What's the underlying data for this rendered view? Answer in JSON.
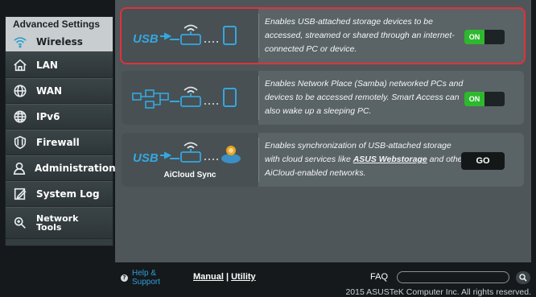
{
  "sidebar": {
    "header": "Advanced Settings",
    "items": [
      {
        "label": "Wireless",
        "icon": "wifi-icon"
      },
      {
        "label": "LAN",
        "icon": "home-icon"
      },
      {
        "label": "WAN",
        "icon": "globe-icon"
      },
      {
        "label": "IPv6",
        "icon": "ipv6-globe-icon"
      },
      {
        "label": "Firewall",
        "icon": "shield-icon"
      },
      {
        "label": "Administration",
        "icon": "person-icon"
      },
      {
        "label": "System Log",
        "icon": "log-pencil-icon"
      },
      {
        "label": "Network",
        "label2": "Tools",
        "icon": "network-tools-icon"
      }
    ]
  },
  "cards": [
    {
      "description": "Enables USB-attached storage devices to be accessed, streamed or shared through an internet-connected PC or device.",
      "toggle": "ON"
    },
    {
      "description": "Enables Network Place (Samba) networked PCs and devices to be accessed remotely. Smart Access can also wake up a sleeping PC.",
      "toggle": "ON"
    },
    {
      "caption": "AiCloud Sync",
      "desc_before": "Enables synchronization of USB-attached storage with cloud services like ",
      "desc_link": "ASUS Webstorage",
      "desc_after": " and other AiCloud-enabled networks.",
      "button": "GO"
    }
  ],
  "footer": {
    "help": "Help & Support",
    "manual": "Manual",
    "separator": "|",
    "utility": "Utility",
    "faq": "FAQ",
    "faq_value": "",
    "copyright": "2015 ASUSTeK Computer Inc. All rights reserved."
  },
  "colors": {
    "accent_on": "#2eb82e",
    "selection": "#e0313a",
    "link_blue": "#2e9fd8"
  }
}
